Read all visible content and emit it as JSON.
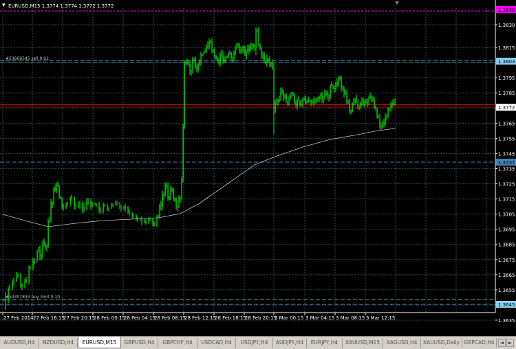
{
  "chart": {
    "symbol_info": "EURUSD,M15  1.3774 1.3774 1.3772 1.3772",
    "price_labels": [
      "1.3830",
      "1.3815",
      "1.3805",
      "1.3795",
      "1.3785",
      "1.3775",
      "1.3765",
      "1.3755",
      "1.3745",
      "1.3735",
      "1.3725",
      "1.3715",
      "1.3705",
      "1.3695",
      "1.3685",
      "1.3675",
      "1.3665",
      "1.3655",
      "1.3645",
      "1.3635"
    ],
    "time_labels": [
      "27 Feb 2014",
      "27 Feb 16:15",
      "27 Feb 20:15",
      "28 Feb 00:15",
      "28 Feb 04:15",
      "28 Feb 08:15",
      "28 Feb 12:15",
      "28 Feb 16:15",
      "28 Feb 20:15",
      "3 Mar 00:15",
      "3 Mar 04:15",
      "3 Mar 08:15",
      "3 Mar 12:15"
    ],
    "order_sell_label": "#53669545 sell 0.01",
    "order_buy_label": "#53307833 buy limit 0.10",
    "tags": {
      "top": "1.3836",
      "sell": "1.3803",
      "current": "1.3772",
      "mid": "1.3737",
      "buy": "1.3645"
    },
    "colors": {
      "candle": "#00ff00",
      "grid": "#2f4f4f",
      "bid_line": "#ff0000",
      "magenta": "#ff00ff",
      "dashed": "#5f9ea0",
      "ma": "#c0c0c0"
    }
  },
  "tabs": [
    "AUDUSD,H4",
    "NZDUSD,H4",
    "EURUSD,M15",
    "GBPUSD,H4",
    "GBPCHF,H4",
    "USDCAD,H4",
    "USDJPY,H4",
    "AUDJPY,H4",
    "EURJPY,H4",
    "XAUUSD,M15",
    "XAGUSD,H4",
    "XAUUSD,Daily",
    "GBPCAD,H4"
  ],
  "active_tab": 2
}
